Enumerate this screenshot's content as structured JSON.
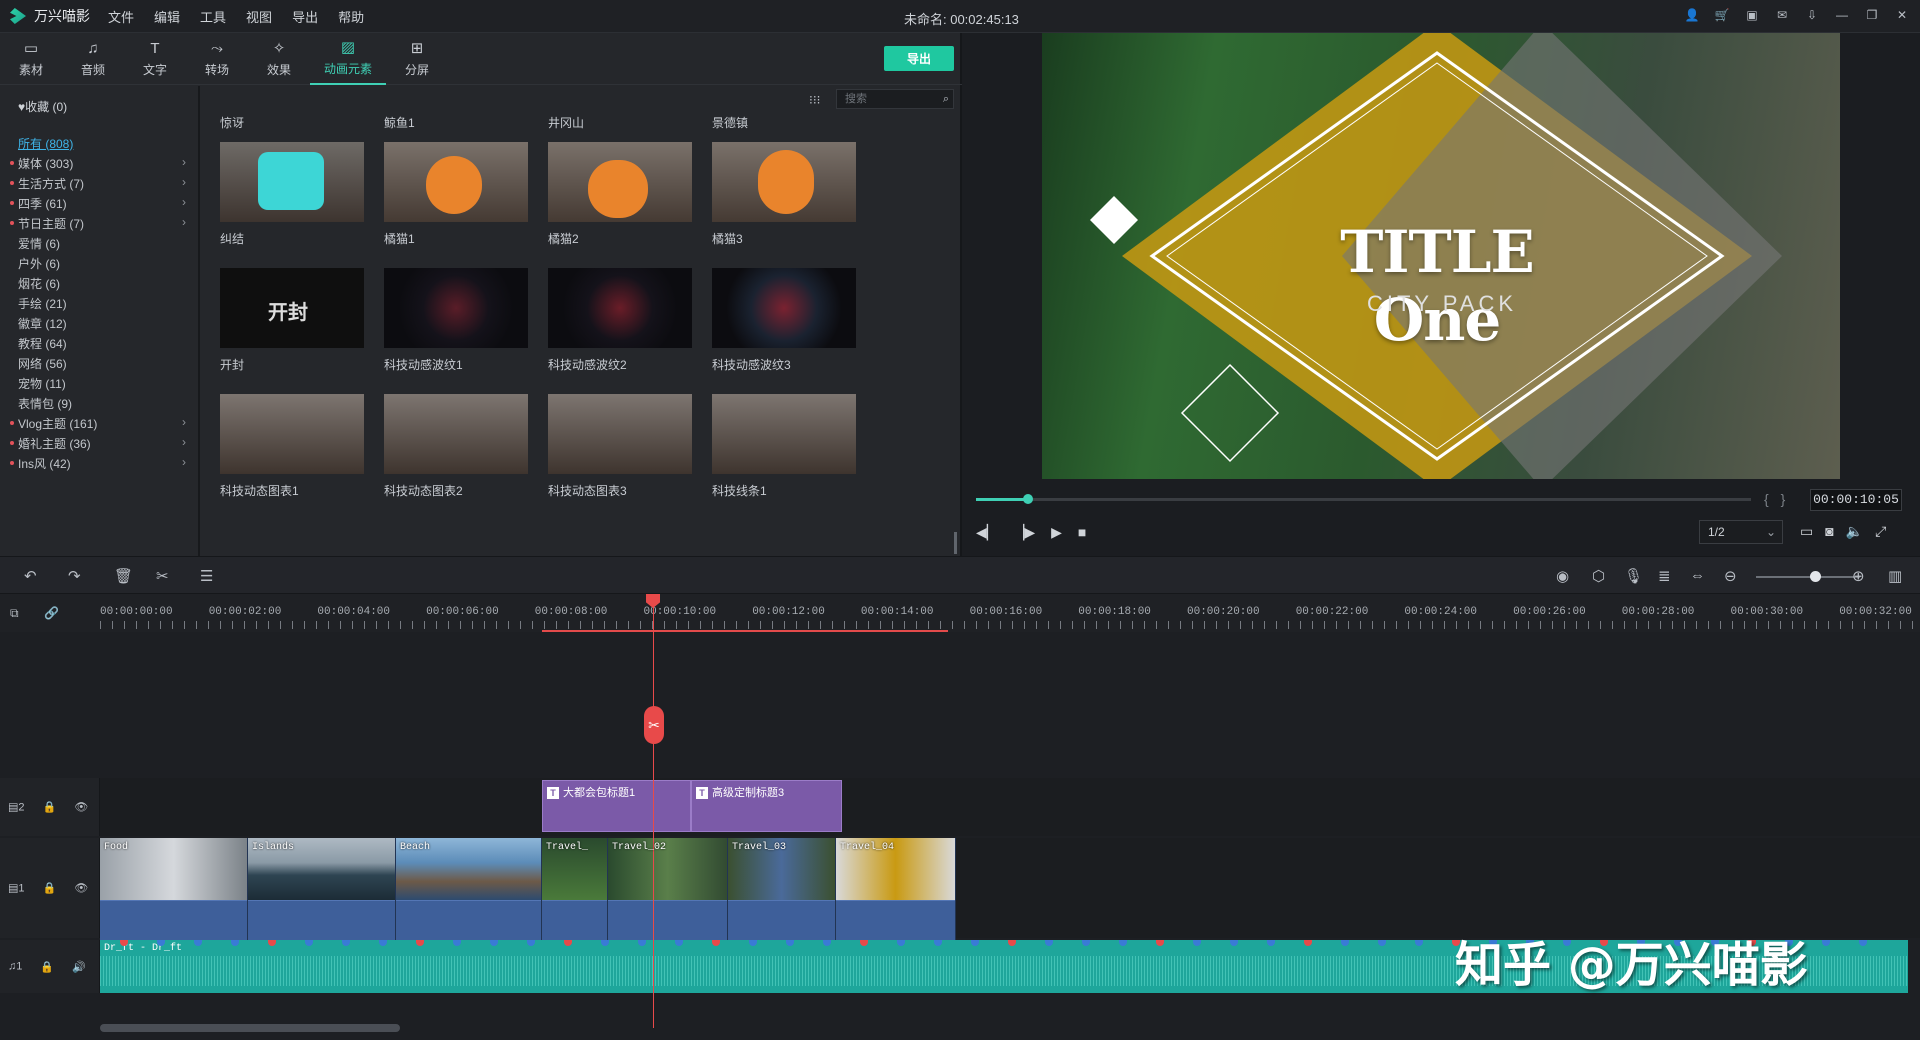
{
  "app": {
    "name": "万兴喵影",
    "project_title": "未命名: 00:02:45:13"
  },
  "menu": [
    "文件",
    "编辑",
    "工具",
    "视图",
    "导出",
    "帮助"
  ],
  "toolbar": {
    "tabs": [
      {
        "label": "素材",
        "icon": "folder-icon"
      },
      {
        "label": "音频",
        "icon": "music-icon"
      },
      {
        "label": "文字",
        "icon": "text-icon"
      },
      {
        "label": "转场",
        "icon": "transition-icon"
      },
      {
        "label": "效果",
        "icon": "effects-icon"
      },
      {
        "label": "动画元素",
        "icon": "elements-icon"
      },
      {
        "label": "分屏",
        "icon": "splitscreen-icon"
      }
    ],
    "active_tab": "动画元素",
    "export_label": "导出"
  },
  "categories": {
    "favorites": "收藏 (0)",
    "items": [
      {
        "label": "所有 (808)",
        "selected": true,
        "dot": false,
        "arrow": false
      },
      {
        "label": "媒体 (303)",
        "dot": true,
        "arrow": true
      },
      {
        "label": "生活方式 (7)",
        "dot": true,
        "arrow": true
      },
      {
        "label": "四季 (61)",
        "dot": true,
        "arrow": true
      },
      {
        "label": "节日主题 (7)",
        "dot": true,
        "arrow": true
      },
      {
        "label": "爱情 (6)",
        "dot": false,
        "arrow": false
      },
      {
        "label": "户外 (6)",
        "dot": false,
        "arrow": false
      },
      {
        "label": "烟花 (6)",
        "dot": false,
        "arrow": false
      },
      {
        "label": "手绘 (21)",
        "dot": false,
        "arrow": false
      },
      {
        "label": "徽章 (12)",
        "dot": false,
        "arrow": false
      },
      {
        "label": "教程 (64)",
        "dot": false,
        "arrow": false
      },
      {
        "label": "网络 (56)",
        "dot": false,
        "arrow": false
      },
      {
        "label": "宠物 (11)",
        "dot": false,
        "arrow": false
      },
      {
        "label": "表情包 (9)",
        "dot": false,
        "arrow": false
      },
      {
        "label": "Vlog主题 (161)",
        "dot": true,
        "arrow": true
      },
      {
        "label": "婚礼主题 (36)",
        "dot": true,
        "arrow": true
      },
      {
        "label": "Ins风 (42)",
        "dot": true,
        "arrow": true
      }
    ]
  },
  "search": {
    "placeholder": "搜索"
  },
  "elements": [
    [
      "惊讶",
      "鲸鱼1",
      "井冈山",
      "景德镇"
    ],
    [
      "纠结",
      "橘猫1",
      "橘猫2",
      "橘猫3"
    ],
    [
      "开封",
      "科技动感波纹1",
      "科技动感波纹2",
      "科技动感波纹3"
    ],
    [
      "科技动态图表1",
      "科技动态图表2",
      "科技动态图表3",
      "科技线条1"
    ]
  ],
  "preview": {
    "title_main": "TITLE One",
    "title_sub": "CITY PACK",
    "timecode": "00:00:10:05",
    "ratio": "1/2",
    "progress_fraction": 0.067
  },
  "timeline": {
    "ticks": [
      "00:00:00:00",
      "00:00:02:00",
      "00:00:04:00",
      "00:00:06:00",
      "00:00:08:00",
      "00:00:10:00",
      "00:00:12:00",
      "00:00:14:00",
      "00:00:16:00",
      "00:00:18:00",
      "00:00:20:00",
      "00:00:22:00",
      "00:00:24:00",
      "00:00:26:00",
      "00:00:28:00",
      "00:00:30:00",
      "00:00:32:00"
    ],
    "tracks": [
      {
        "label": "2",
        "type": "video"
      },
      {
        "label": "1",
        "type": "video"
      },
      {
        "label": "1",
        "type": "audio"
      }
    ],
    "title_clips": [
      "大都会包标题1",
      "高级定制标题3"
    ],
    "video_clips": [
      "Food",
      "Islands",
      "Beach",
      "Travel_",
      "Travel_02",
      "Travel_03",
      "Travel_04"
    ],
    "audio_clip": "Dr_ft - Dr_ft"
  },
  "watermark": "知乎 @万兴喵影"
}
